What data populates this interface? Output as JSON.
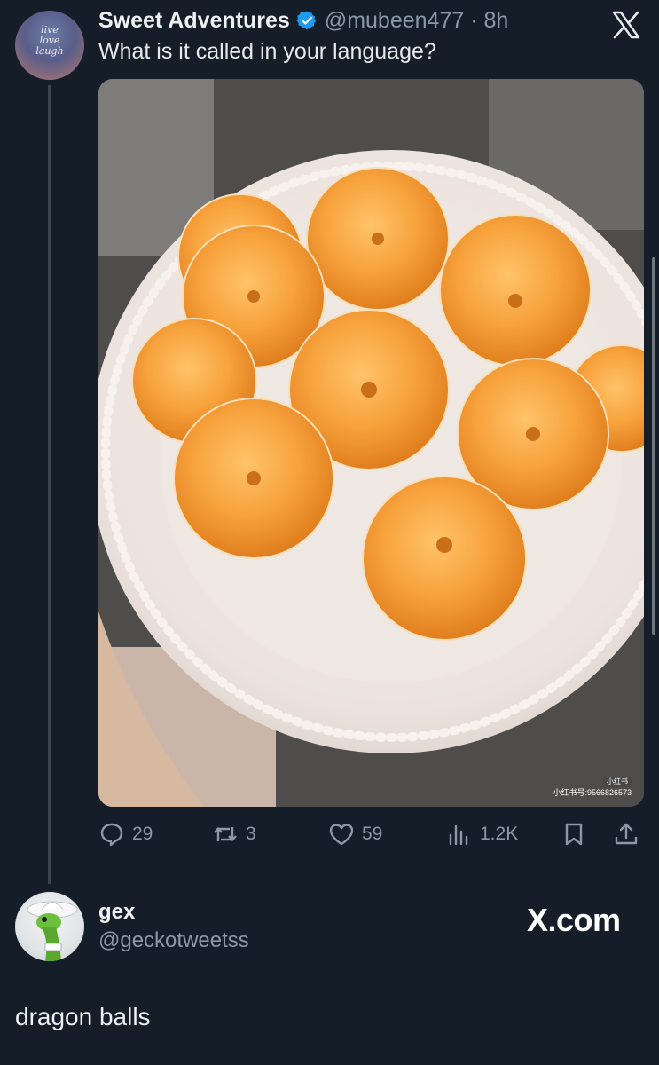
{
  "tweet": {
    "display_name": "Sweet Adventures",
    "handle_time": "@mubeen477 · 8h",
    "text": "What is it called in your language?",
    "avatar_text": "live love laugh",
    "photo_watermark_badge": "小红书",
    "photo_watermark_id": "小红书号:9566826573",
    "actions": {
      "replies": "29",
      "reposts": "3",
      "likes": "59",
      "views": "1.2K"
    }
  },
  "reply": {
    "display_name": "gex",
    "handle": "@geckotweetss",
    "text": "dragon balls"
  },
  "brand_mark": "X.com",
  "colors": {
    "background": "#151d28",
    "secondary_text": "#8b98a5",
    "verified": "#1d9bf0"
  },
  "icons": [
    "verified-badge-icon",
    "x-logo-icon",
    "reply-icon",
    "repost-icon",
    "like-icon",
    "views-icon",
    "bookmark-icon",
    "share-icon"
  ]
}
